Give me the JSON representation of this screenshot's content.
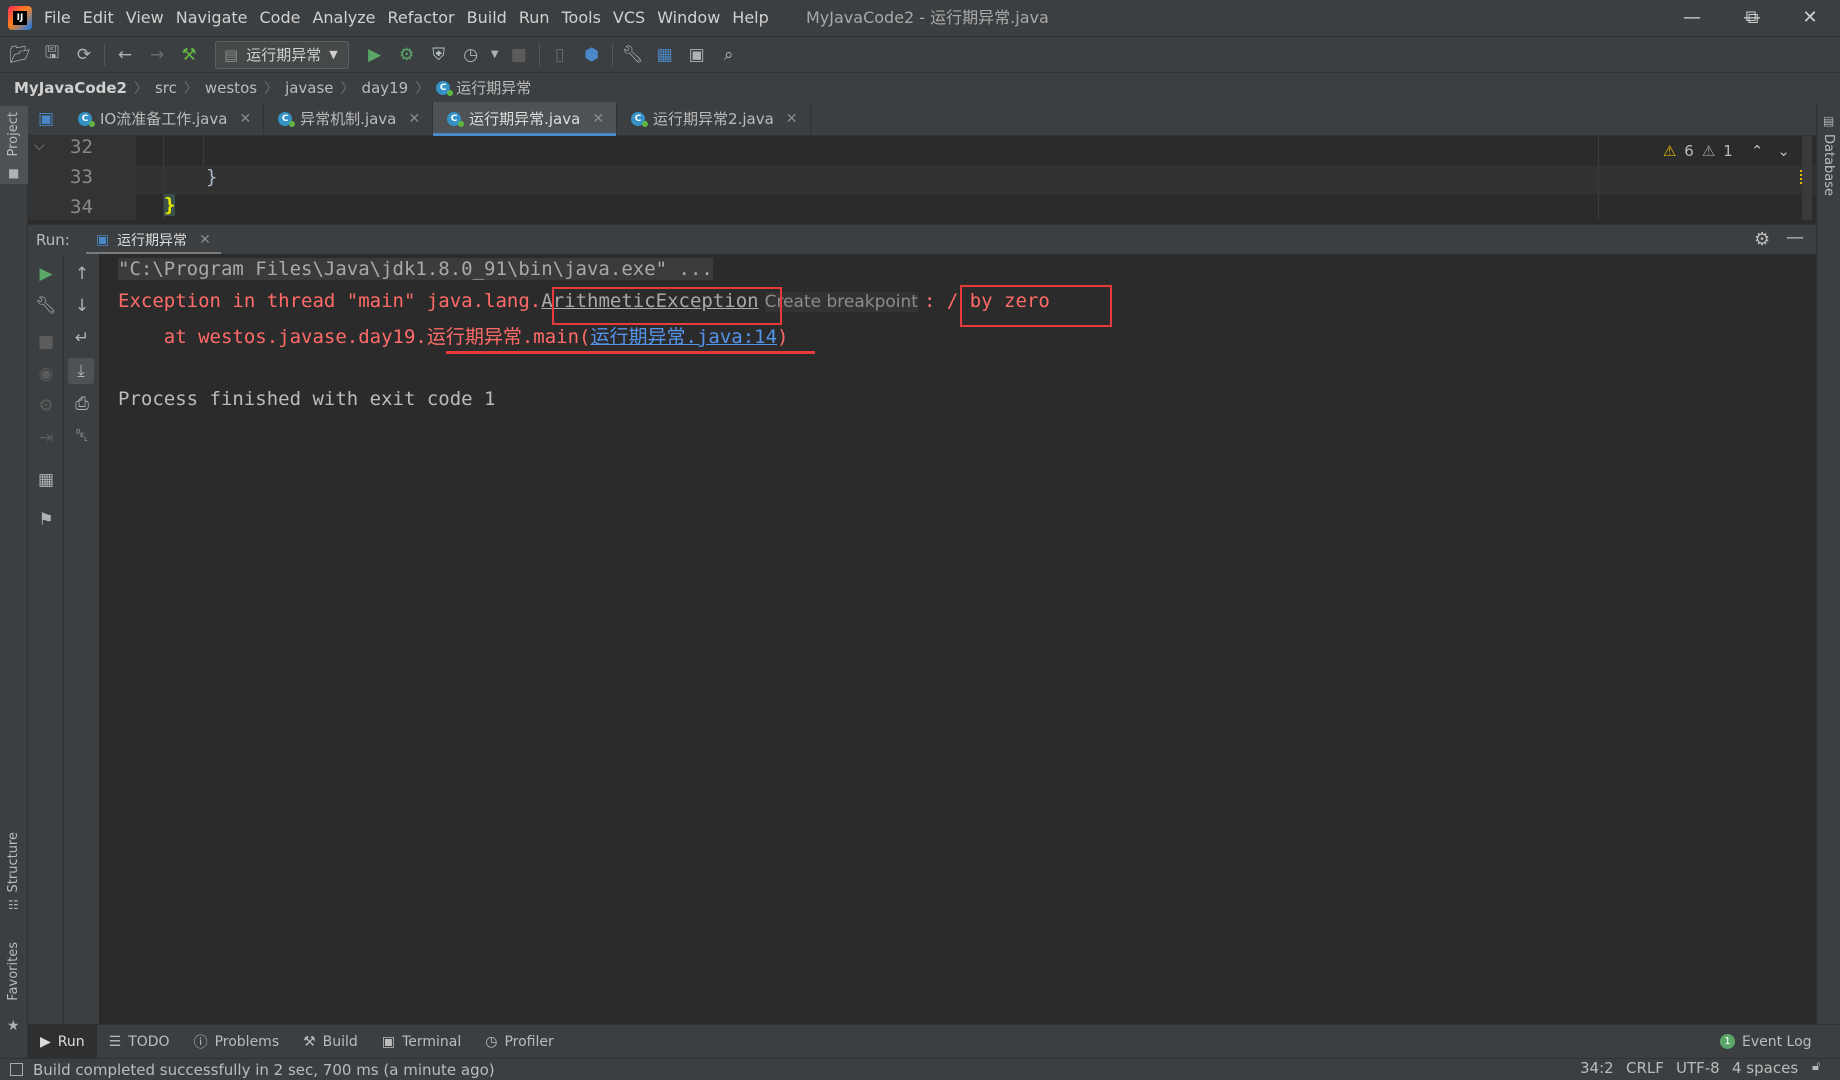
{
  "window": {
    "title": "MyJavaCode2 - 运行期异常.java",
    "menu": [
      "File",
      "Edit",
      "View",
      "Navigate",
      "Code",
      "Analyze",
      "Refactor",
      "Build",
      "Run",
      "Tools",
      "VCS",
      "Window",
      "Help"
    ],
    "logo_text": "IJ"
  },
  "toolbar": {
    "run_config": "运行期异常"
  },
  "breadcrumb": [
    "MyJavaCode2",
    "src",
    "westos",
    "javase",
    "day19",
    "运行期异常"
  ],
  "sidebar": {
    "project_label": "Project",
    "structure_label": "Structure",
    "favorites_label": "Favorites",
    "database_label": "Database"
  },
  "editor_tabs": [
    {
      "label": "IO流准备工作.java",
      "active": false
    },
    {
      "label": "异常机制.java",
      "active": false
    },
    {
      "label": "运行期异常.java",
      "active": true
    },
    {
      "label": "运行期异常2.java",
      "active": false
    }
  ],
  "editor": {
    "lines": [
      {
        "num": "32",
        "code": ""
      },
      {
        "num": "33",
        "code": "}"
      },
      {
        "num": "34",
        "code": "}"
      }
    ],
    "warnings": "6",
    "weak_warnings": "1"
  },
  "run_panel": {
    "label": "Run:",
    "tab_label": "运行期异常",
    "console": {
      "cmd": "\"C:\\Program Files\\Java\\jdk1.8.0_91\\bin\\java.exe\" ...",
      "ex_prefix": "Exception in thread \"main\" java.lang.",
      "ex_class": "ArithmeticException",
      "breakpoint_hint": "Create breakpoint",
      "ex_message": ": / by zero",
      "at_prefix": "    at westos.javase.day19.",
      "at_method": "运行期异常.main(",
      "at_link_cn": "运行期异常",
      "at_link_file": ".java:14",
      "at_close": ")",
      "finish": "Process finished with exit code 1"
    }
  },
  "bottom_tabs": [
    "Run",
    "TODO",
    "Problems",
    "Build",
    "Terminal",
    "Profiler"
  ],
  "event_log": {
    "label": "Event Log",
    "count": "1"
  },
  "status": {
    "message": "Build completed successfully in 2 sec, 700 ms (a minute ago)",
    "position": "34:2",
    "line_sep": "CRLF",
    "encoding": "UTF-8",
    "indent": "4 spaces"
  },
  "colors": {
    "accent": "#4a88c7",
    "error": "#ff6b68",
    "highlight_box": "#e83a3a",
    "link": "#5394ec",
    "warning": "#e5b800"
  }
}
